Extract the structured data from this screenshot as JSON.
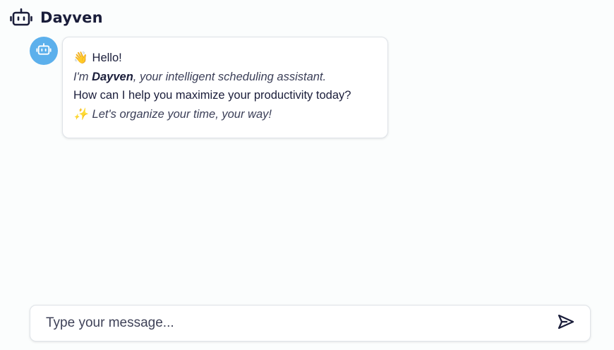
{
  "header": {
    "logo_icon": "robot-icon",
    "title": "Dayven"
  },
  "chat": {
    "messages": [
      {
        "sender": "bot",
        "avatar_icon": "robot-icon",
        "avatar_color": "#5cb0ec",
        "greeting_emoji": "👋",
        "greeting": "Hello!",
        "intro_prefix": "I'm ",
        "intro_name": "Dayven",
        "intro_suffix": ", your intelligent scheduling assistant.",
        "question": "How can I help you maximize your productivity today?",
        "tagline_emoji": "✨",
        "tagline": "Let's organize your time, your way!"
      }
    ]
  },
  "composer": {
    "placeholder": "Type your message...",
    "value": "",
    "send_icon": "send-icon"
  },
  "colors": {
    "background": "#fbfdfd",
    "text": "#1a1d3a",
    "accent": "#5cb0ec"
  }
}
